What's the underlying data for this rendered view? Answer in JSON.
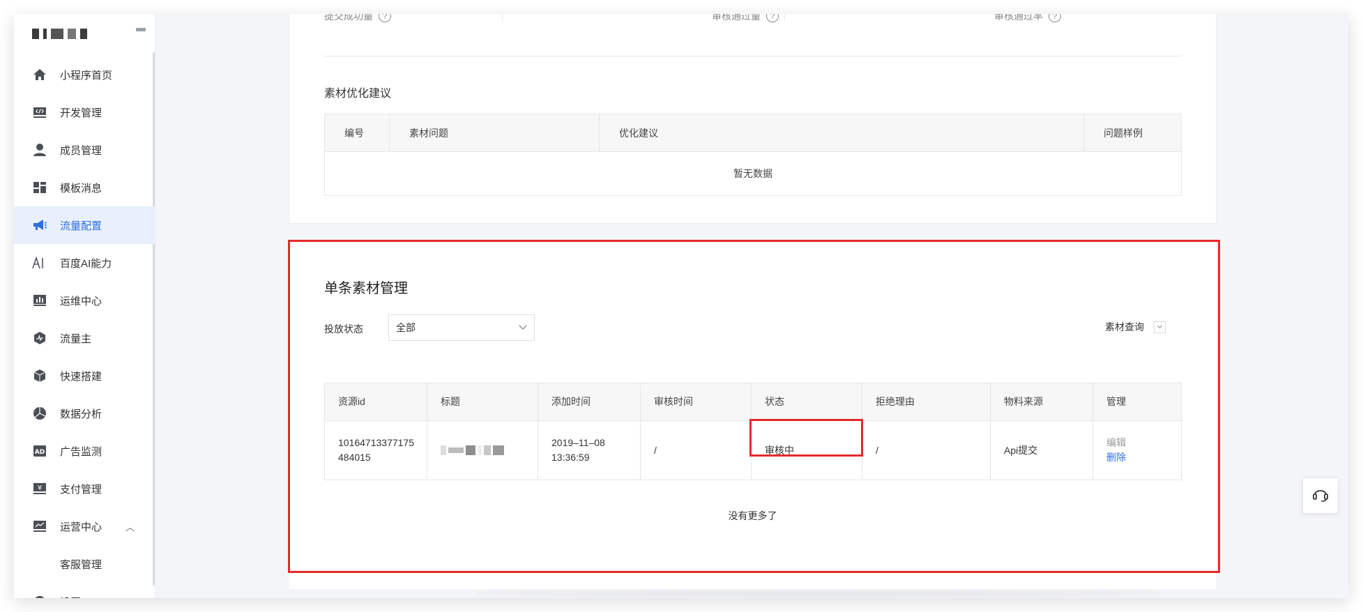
{
  "sidebar": {
    "items": [
      {
        "label": "小程序首页",
        "icon": "home-icon"
      },
      {
        "label": "开发管理",
        "icon": "code-icon"
      },
      {
        "label": "成员管理",
        "icon": "user-icon"
      },
      {
        "label": "模板消息",
        "icon": "template-icon"
      },
      {
        "label": "流量配置",
        "icon": "megaphone-icon",
        "active": true
      },
      {
        "label": "百度AI能力",
        "icon": "ai-icon"
      },
      {
        "label": "运维中心",
        "icon": "chart-icon"
      },
      {
        "label": "流量主",
        "icon": "traffic-icon"
      },
      {
        "label": "快速搭建",
        "icon": "cube-icon"
      },
      {
        "label": "数据分析",
        "icon": "pie-icon"
      },
      {
        "label": "广告监测",
        "icon": "ad-icon"
      },
      {
        "label": "支付管理",
        "icon": "payment-icon"
      },
      {
        "label": "运营中心",
        "icon": "operation-icon",
        "expanded": true
      },
      {
        "label": "客服管理",
        "icon": ""
      },
      {
        "label": "设置",
        "icon": "settings-icon"
      }
    ],
    "accent": "#2f6fdf",
    "active_bg": "#e8f0fc"
  },
  "metrics": [
    {
      "label": "提交成功量"
    },
    {
      "label": "审核通过量"
    },
    {
      "label": "审核通过率"
    }
  ],
  "suggestions": {
    "title": "素材优化建议",
    "columns": [
      "编号",
      "素材问题",
      "优化建议",
      "问题样例"
    ],
    "empty_text": "暂无数据"
  },
  "material": {
    "title": "单条素材管理",
    "filter_label": "投放状态",
    "filter_value": "全部",
    "query_label": "素材查询",
    "columns": [
      "资源id",
      "标题",
      "添加时间",
      "审核时间",
      "状态",
      "拒绝理由",
      "物料来源",
      "管理"
    ],
    "row": {
      "id_line1": "10164713377175",
      "id_line2": "484015",
      "added_date": "2019–11–08",
      "added_time": "13:36:59",
      "review_time": "/",
      "status": "审核中",
      "reject_reason": "/",
      "source": "Api提交",
      "edit": "编辑",
      "delete": "删除"
    },
    "no_more": "没有更多了"
  },
  "highlight_color": "#e42a2a"
}
